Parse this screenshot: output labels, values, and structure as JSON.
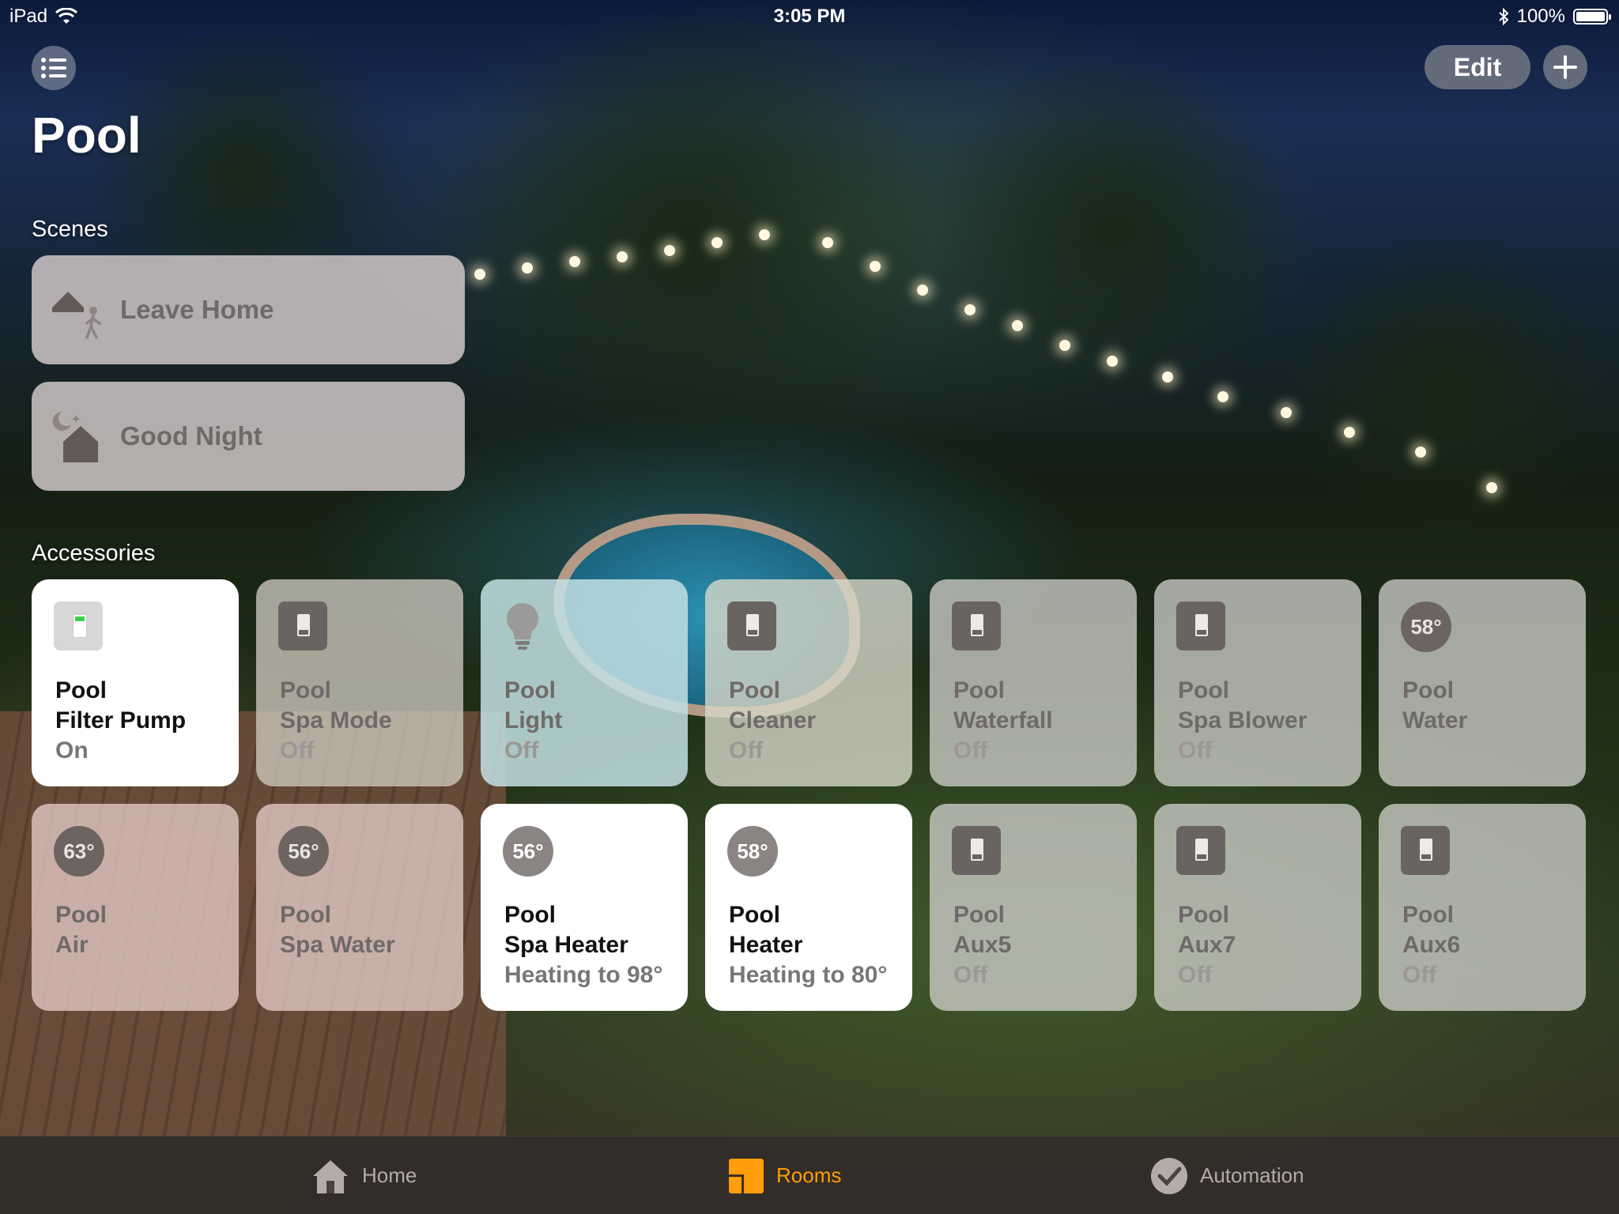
{
  "status_bar": {
    "device": "iPad",
    "time": "3:05 PM",
    "battery": "100%"
  },
  "header": {
    "title": "Pool",
    "edit_label": "Edit",
    "icons": [
      "list-icon",
      "plus-icon"
    ]
  },
  "scenes": {
    "label": "Scenes",
    "items": [
      {
        "label": "Leave Home",
        "icon": "leave-home-icon"
      },
      {
        "label": "Good Night",
        "icon": "good-night-icon"
      }
    ]
  },
  "accessories": {
    "label": "Accessories",
    "items": [
      {
        "line1": "Pool",
        "line2": "Filter Pump",
        "status": "On",
        "icon": "switch-icon",
        "on": true
      },
      {
        "line1": "Pool",
        "line2": "Spa Mode",
        "status": "Off",
        "icon": "switch-icon",
        "on": false
      },
      {
        "line1": "Pool",
        "line2": "Light",
        "status": "Off",
        "icon": "bulb-icon",
        "on": false
      },
      {
        "line1": "Pool",
        "line2": "Cleaner",
        "status": "Off",
        "icon": "switch-icon",
        "on": false
      },
      {
        "line1": "Pool",
        "line2": "Waterfall",
        "status": "Off",
        "icon": "switch-icon",
        "on": false
      },
      {
        "line1": "Pool",
        "line2": "Spa Blower",
        "status": "Off",
        "icon": "switch-icon",
        "on": false
      },
      {
        "line1": "Pool",
        "line2": "Water",
        "status": "",
        "icon": "thermometer-icon",
        "temp": "58°",
        "on": false
      },
      {
        "line1": "Pool",
        "line2": "Air",
        "status": "",
        "icon": "thermometer-icon",
        "temp": "63°",
        "on": false
      },
      {
        "line1": "Pool",
        "line2": "Spa Water",
        "status": "",
        "icon": "thermometer-icon",
        "temp": "56°",
        "on": false
      },
      {
        "line1": "Pool",
        "line2": "Spa Heater",
        "status": "Heating to 98°",
        "icon": "thermostat-icon",
        "temp": "56°",
        "on": true
      },
      {
        "line1": "Pool",
        "line2": "Heater",
        "status": "Heating to 80°",
        "icon": "thermostat-icon",
        "temp": "58°",
        "on": true
      },
      {
        "line1": "Pool",
        "line2": "Aux5",
        "status": "Off",
        "icon": "switch-icon",
        "on": false
      },
      {
        "line1": "Pool",
        "line2": "Aux7",
        "status": "Off",
        "icon": "switch-icon",
        "on": false
      },
      {
        "line1": "Pool",
        "line2": "Aux6",
        "status": "Off",
        "icon": "switch-icon",
        "on": false
      }
    ]
  },
  "tab_bar": {
    "items": [
      {
        "label": "Home",
        "icon": "home-icon",
        "active": false
      },
      {
        "label": "Rooms",
        "icon": "rooms-icon",
        "active": true
      },
      {
        "label": "Automation",
        "icon": "automation-icon",
        "active": false
      }
    ],
    "accent_color": "#ff9d0a"
  }
}
